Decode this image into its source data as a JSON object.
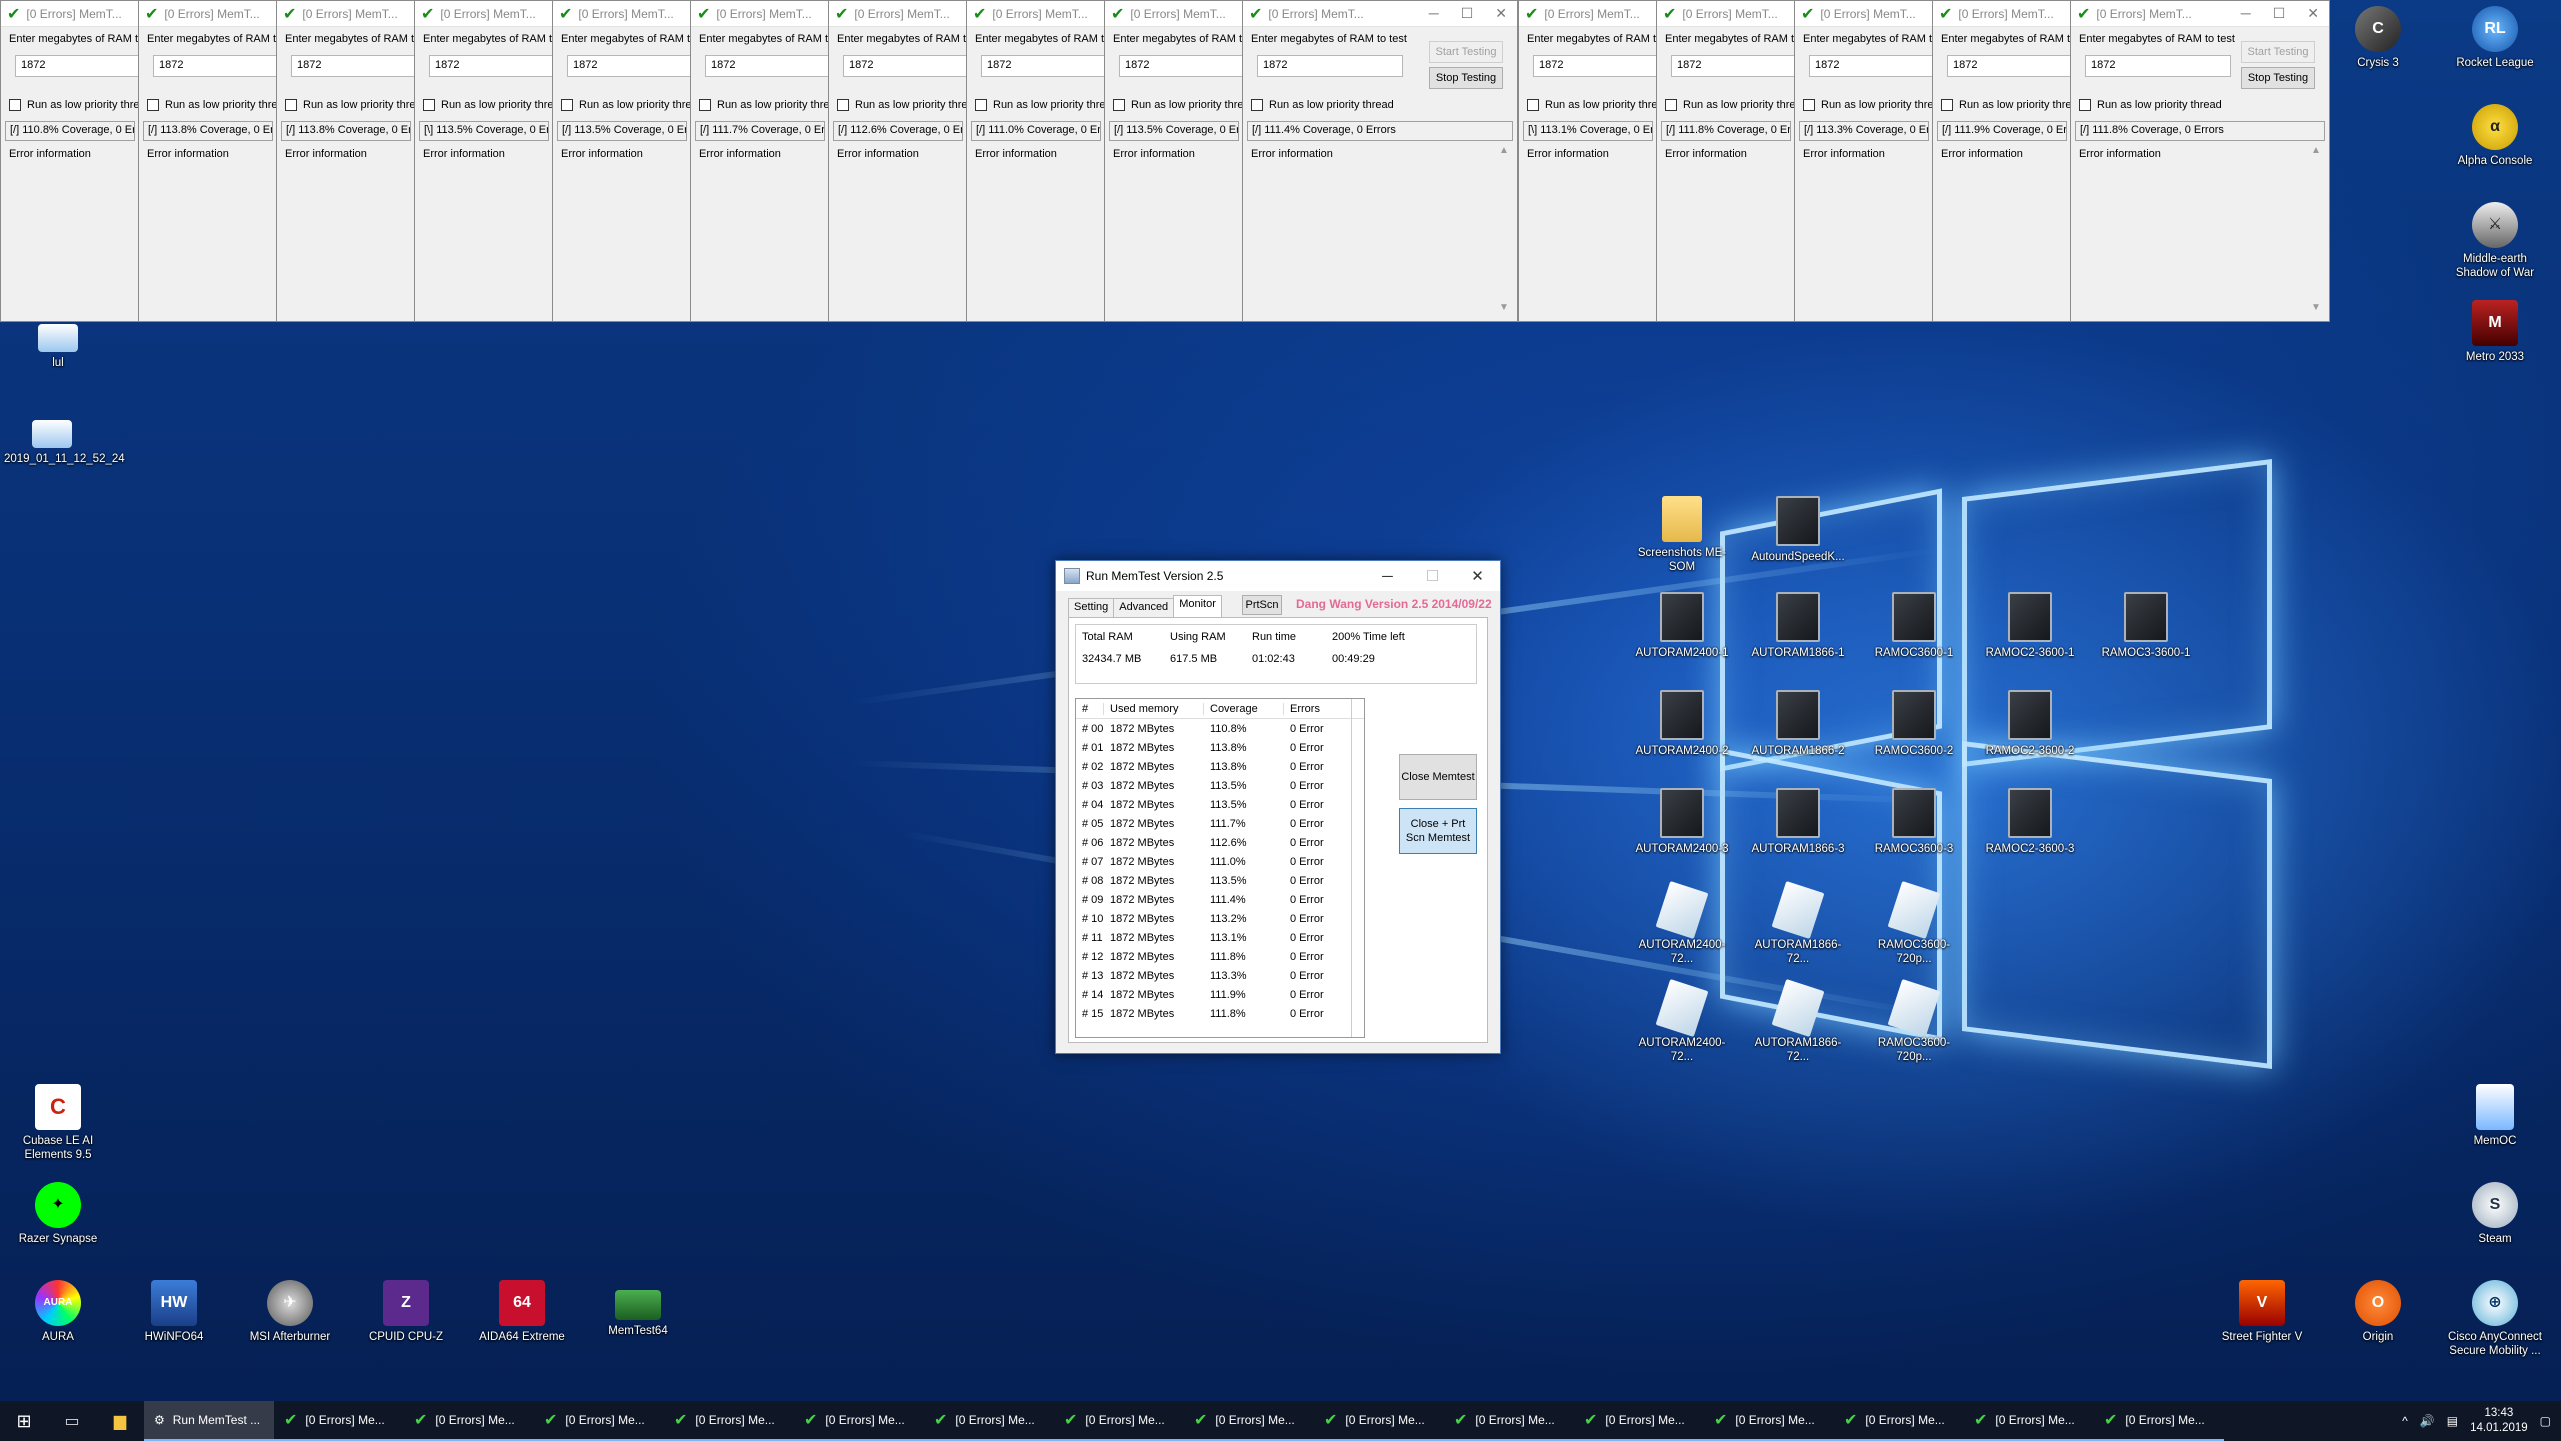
{
  "instance": {
    "title": "[0 Errors] MemT...",
    "prompt": "Enter megabytes of RAM to test",
    "ram_value": "1872",
    "low_priority_label": "Run as low priority thread",
    "start_label": "Start Testing",
    "stop_label": "Stop Testing",
    "error_label": "Error information"
  },
  "instances": [
    {
      "status": "[/]  110.8% Coverage, 0 Errors"
    },
    {
      "status": "[/]  113.8% Coverage, 0 Errors"
    },
    {
      "status": "[/]  113.8% Coverage, 0 Errors"
    },
    {
      "status": "[\\]  113.5% Coverage, 0 Errors"
    },
    {
      "status": "[/]  113.5% Coverage, 0 Errors"
    },
    {
      "status": "[/]  111.7% Coverage, 0 Errors"
    },
    {
      "status": "[/]  112.6% Coverage, 0 Errors"
    },
    {
      "status": "[/]  111.0% Coverage, 0 Errors"
    },
    {
      "status": "[/]  113.5% Coverage, 0 Errors"
    },
    {
      "status": "[/]  111.4% Coverage, 0 Errors"
    },
    {
      "status": "[\\]  113.1% Coverage, 0 Errors"
    },
    {
      "status": "[/]  111.8% Coverage, 0 Errors"
    },
    {
      "status": "[/]  113.3% Coverage, 0 Errors"
    },
    {
      "status": "[/]  111.9% Coverage, 0 Errors"
    },
    {
      "status": "[/]  111.8% Coverage, 0 Errors"
    }
  ],
  "desktop_icons": {
    "crysis": "Crysis 3",
    "rocket": "Rocket League",
    "alpha": "Alpha Console",
    "middle_earth": "Middle-earth Shadow of War",
    "metro": "Metro 2033",
    "lul": "lul",
    "screenshot": "2019_01_11_12_52_24",
    "cubase": "Cubase LE AI Elements 9.5",
    "razer": "Razer Synapse",
    "aura": "AURA",
    "hwinfo": "HWiNFO64",
    "msi": "MSI Afterburner",
    "cpuz": "CPUID CPU-Z",
    "aida": "AIDA64 Extreme",
    "memtest64": "MemTest64",
    "screenshots_folder": "Screenshots ME-SOM",
    "autoundspeed": "AutoundSpeedK...",
    "memoc": "MemOC",
    "steam": "Steam",
    "sfv": "Street Fighter V",
    "origin": "Origin",
    "cisco": "Cisco AnyConnect Secure Mobility ...",
    "files": [
      "AUTORAM2400-1",
      "AUTORAM1866-1",
      "RAMOC3600-1",
      "RAMOC2-3600-1",
      "RAMOC3-3600-1",
      "AUTORAM2400-2",
      "AUTORAM1866-2",
      "RAMOC3600-2",
      "RAMOC2-3600-2",
      "AUTORAM2400-3",
      "AUTORAM1866-3",
      "RAMOC3600-3",
      "RAMOC2-3600-3",
      "AUTORAM2400-72...",
      "AUTORAM1866-72...",
      "RAMOC3600-720p...",
      "AUTORAM2400-72...",
      "AUTORAM1866-72...",
      "RAMOC3600-720p..."
    ]
  },
  "dialog": {
    "title": "Run MemTest Version 2.5",
    "tabs": [
      "Setting",
      "Advanced",
      "Monitor"
    ],
    "prtscn": "PrtScn",
    "version": "Dang Wang Version 2.5 2014/09/22",
    "summary": {
      "total_ram_label": "Total RAM",
      "total_ram": "32434.7 MB",
      "using_ram_label": "Using RAM",
      "using_ram": "617.5 MB",
      "run_time_label": "Run time",
      "run_time": "01:02:43",
      "time_left_label": "200% Time left",
      "time_left": "00:49:29"
    },
    "grid_headers": [
      "#",
      "Used memory",
      "Coverage",
      "Errors"
    ],
    "rows": [
      [
        "# 00",
        "1872 MBytes",
        "110.8%",
        "0 Error"
      ],
      [
        "# 01",
        "1872 MBytes",
        "113.8%",
        "0 Error"
      ],
      [
        "# 02",
        "1872 MBytes",
        "113.8%",
        "0 Error"
      ],
      [
        "# 03",
        "1872 MBytes",
        "113.5%",
        "0 Error"
      ],
      [
        "# 04",
        "1872 MBytes",
        "113.5%",
        "0 Error"
      ],
      [
        "# 05",
        "1872 MBytes",
        "111.7%",
        "0 Error"
      ],
      [
        "# 06",
        "1872 MBytes",
        "112.6%",
        "0 Error"
      ],
      [
        "# 07",
        "1872 MBytes",
        "111.0%",
        "0 Error"
      ],
      [
        "# 08",
        "1872 MBytes",
        "113.5%",
        "0 Error"
      ],
      [
        "# 09",
        "1872 MBytes",
        "111.4%",
        "0 Error"
      ],
      [
        "# 10",
        "1872 MBytes",
        "113.2%",
        "0 Error"
      ],
      [
        "# 11",
        "1872 MBytes",
        "113.1%",
        "0 Error"
      ],
      [
        "# 12",
        "1872 MBytes",
        "111.8%",
        "0 Error"
      ],
      [
        "# 13",
        "1872 MBytes",
        "113.3%",
        "0 Error"
      ],
      [
        "# 14",
        "1872 MBytes",
        "111.9%",
        "0 Error"
      ],
      [
        "# 15",
        "1872 MBytes",
        "111.8%",
        "0 Error"
      ]
    ],
    "close_button": "Close Memtest",
    "close_prtscn_line1": "Close +   Prt",
    "close_prtscn_line2": "Scn Memtest"
  },
  "taskbar": {
    "active_item": "Run MemTest ...",
    "item_label": "[0 Errors] Me...",
    "item_count": 15,
    "time": "13:43",
    "date": "14.01.2019"
  }
}
